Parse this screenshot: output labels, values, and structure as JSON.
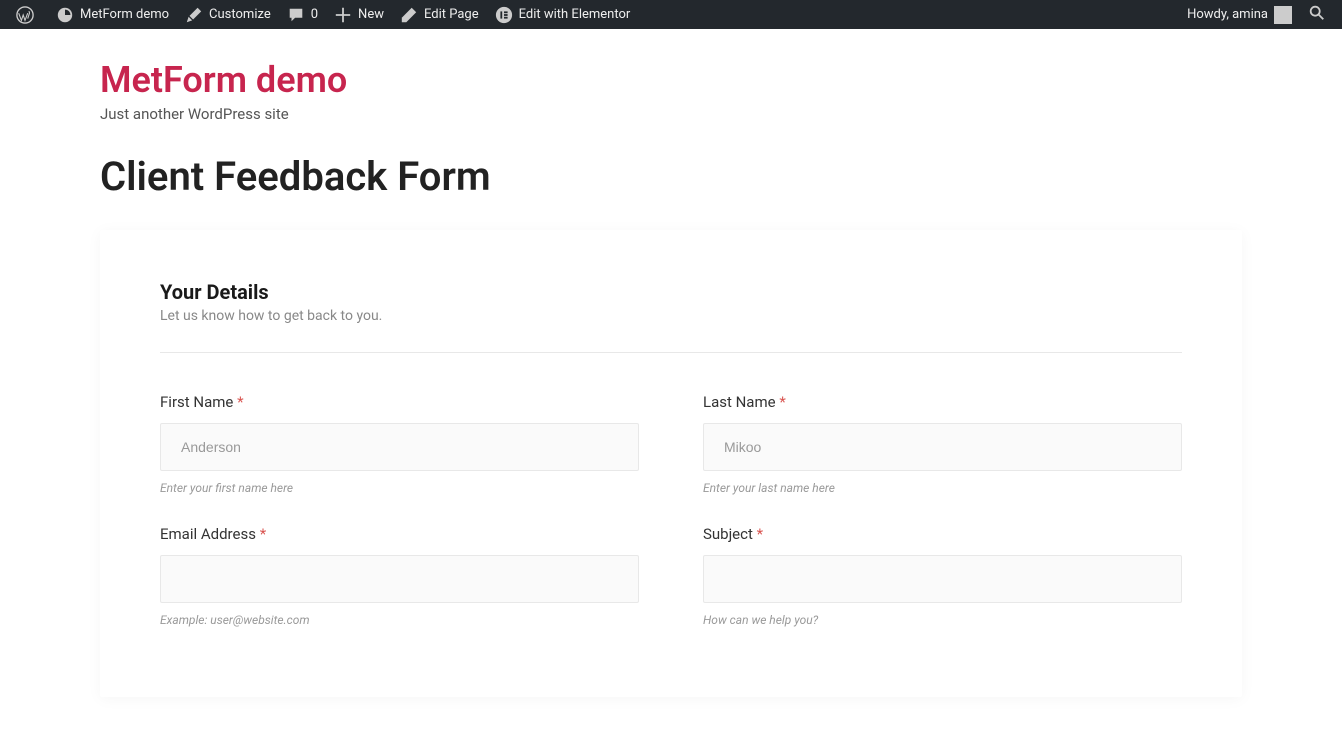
{
  "adminbar": {
    "site_name": "MetForm demo",
    "customize": "Customize",
    "comments_count": "0",
    "new": "New",
    "edit_page": "Edit Page",
    "edit_elementor": "Edit with Elementor",
    "howdy": "Howdy, amina"
  },
  "site": {
    "title": "MetForm demo",
    "tagline": "Just another WordPress site"
  },
  "page": {
    "title": "Client Feedback Form"
  },
  "form": {
    "section_title": "Your Details",
    "section_subtitle": "Let us know how to get back to you.",
    "fields": {
      "first_name": {
        "label": "First Name",
        "placeholder": "Anderson",
        "hint": "Enter your first name here"
      },
      "last_name": {
        "label": "Last Name",
        "placeholder": "Mikoo",
        "hint": "Enter your last name here"
      },
      "email": {
        "label": "Email Address",
        "placeholder": "",
        "hint": "Example: user@website.com"
      },
      "subject": {
        "label": "Subject",
        "placeholder": "",
        "hint": "How can we help you?"
      }
    }
  }
}
